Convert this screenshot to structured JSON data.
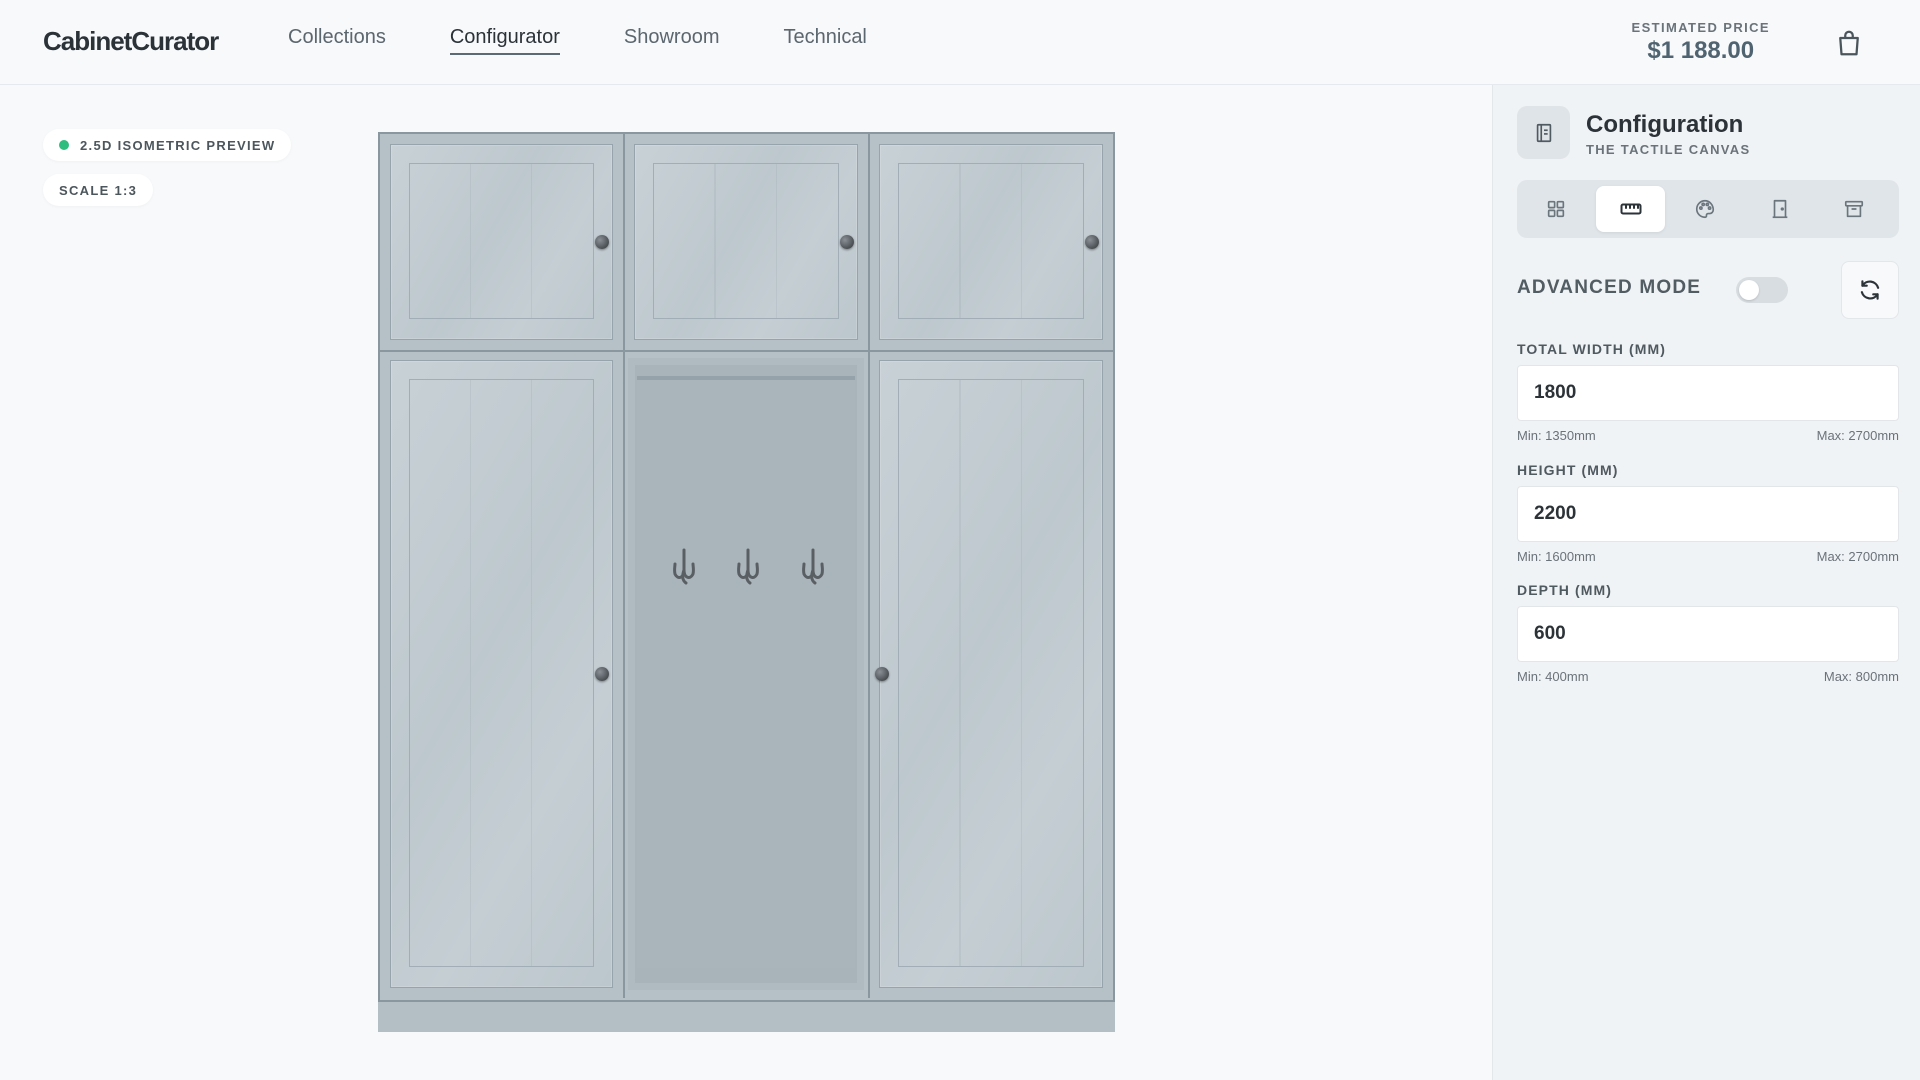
{
  "header": {
    "logo": "CabinetCurator",
    "nav": [
      {
        "label": "Collections",
        "active": false
      },
      {
        "label": "Configurator",
        "active": true
      },
      {
        "label": "Showroom",
        "active": false
      },
      {
        "label": "Technical",
        "active": false
      }
    ],
    "price_label": "ESTIMATED PRICE",
    "price_value": "$1 188.00",
    "cart_icon": "shopping-bag-icon"
  },
  "canvas": {
    "preview_badge": "2.5D ISOMETRIC PREVIEW",
    "scale_badge": "SCALE 1:3",
    "status_color": "#2ebd7f",
    "cabinet_color": "#b6c1c7"
  },
  "sidebar": {
    "title": "Configuration",
    "subtitle": "THE TACTILE CANVAS",
    "tabs": [
      {
        "icon": "grid-icon",
        "active": false
      },
      {
        "icon": "ruler-icon",
        "active": true
      },
      {
        "icon": "palette-icon",
        "active": false
      },
      {
        "icon": "door-icon",
        "active": false
      },
      {
        "icon": "archive-box-icon",
        "active": false
      }
    ],
    "advanced_mode_label": "ADVANCED MODE",
    "advanced_mode_on": false,
    "fields": {
      "width": {
        "label": "TOTAL WIDTH (MM)",
        "value": "1800",
        "min": "Min: 1350mm",
        "max": "Max: 2700mm"
      },
      "height": {
        "label": "HEIGHT (MM)",
        "value": "2200",
        "min": "Min: 1600mm",
        "max": "Max: 2700mm"
      },
      "depth": {
        "label": "DEPTH (MM)",
        "value": "600",
        "min": "Min: 400mm",
        "max": "Max: 800mm"
      }
    }
  }
}
